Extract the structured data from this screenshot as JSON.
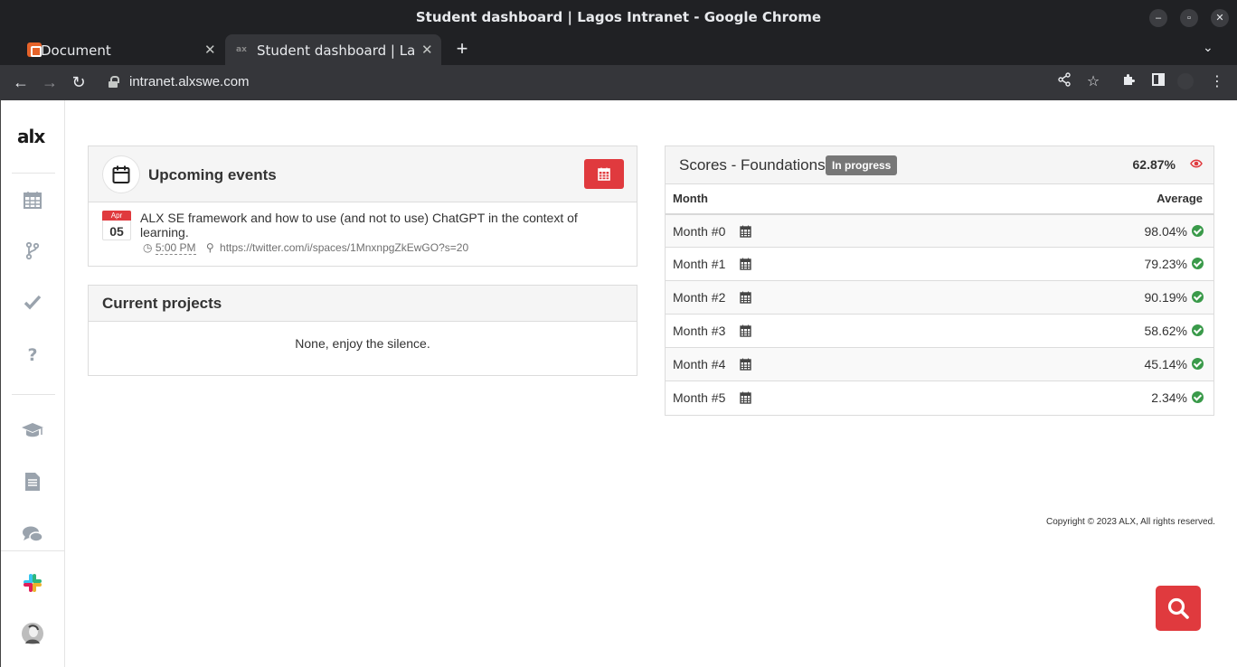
{
  "window": {
    "title": "Student dashboard | Lagos Intranet - Google Chrome"
  },
  "tabs": [
    {
      "label": "Document",
      "favicon": "document-favicon"
    },
    {
      "label": "Student dashboard | Lagos Intranet",
      "favicon": "alx-favicon"
    }
  ],
  "toolbar": {
    "url": "intranet.alxswe.com"
  },
  "sidebar": {
    "logo": "alx",
    "items": [
      {
        "icon": "calendar-icon",
        "label": ""
      },
      {
        "icon": "branch-icon",
        "label": ""
      },
      {
        "icon": "checkmark-icon",
        "label": ""
      },
      {
        "icon": "question-icon",
        "label": ""
      },
      {
        "icon": "graduation-cap-icon",
        "label": ""
      },
      {
        "icon": "document-icon",
        "label": ""
      },
      {
        "icon": "chat-icon",
        "label": ""
      },
      {
        "icon": "slack-icon",
        "label": ""
      },
      {
        "icon": "avatar",
        "label": ""
      }
    ]
  },
  "events": {
    "title": "Upcoming events",
    "items": [
      {
        "month": "Apr",
        "day": "05",
        "title": "ALX SE framework and how to use (and not to use) ChatGPT in the context of learning.",
        "time": "5:00 PM",
        "location": "https://twitter.com/i/spaces/1MnxnpgZkEwGO?s=20"
      }
    ]
  },
  "projects": {
    "title": "Current projects",
    "empty_text": "None, enjoy the silence."
  },
  "scores": {
    "title": "Scores - Foundations",
    "status": "In progress",
    "total": "62.87%",
    "col_month": "Month",
    "col_average": "Average",
    "rows": [
      {
        "month": "Month #0",
        "average": "98.04%"
      },
      {
        "month": "Month #1",
        "average": "79.23%"
      },
      {
        "month": "Month #2",
        "average": "90.19%"
      },
      {
        "month": "Month #3",
        "average": "58.62%"
      },
      {
        "month": "Month #4",
        "average": "45.14%"
      },
      {
        "month": "Month #5",
        "average": "2.34%"
      }
    ]
  },
  "footer": {
    "copyright": "Copyright © 2023 ALX, All rights reserved."
  },
  "colors": {
    "accent": "#e03a3e",
    "success": "#3a9a4a",
    "badge": "#777777"
  }
}
